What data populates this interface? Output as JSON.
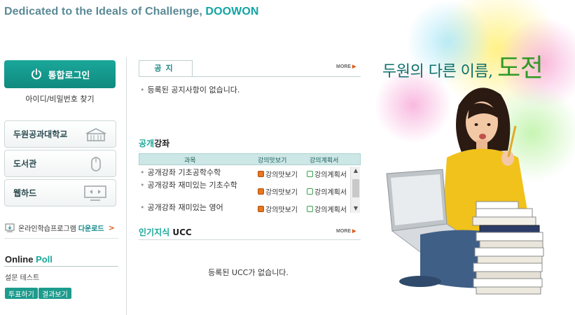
{
  "header": {
    "tagline": "Dedicated to the Ideals of Challenge, ",
    "brand": "DOOWON"
  },
  "sidebar": {
    "login_label": "통합로그인",
    "find_id_label": "아이디/비밀번호 찾기",
    "quick_links": [
      {
        "label": "두원공과대학교",
        "icon": "school-building-icon"
      },
      {
        "label": "도서관",
        "icon": "mouse-icon"
      },
      {
        "label": "웹하드",
        "icon": "monitor-icon"
      }
    ],
    "online_program": {
      "label": "온라인학습프로그램",
      "download_label": "다운로드",
      "arrow": ">"
    },
    "poll": {
      "title_part1": "Online ",
      "title_part2": "Poll",
      "question": "설문 테스트",
      "vote_label": "투표하기",
      "result_label": "결과보기"
    }
  },
  "notice": {
    "tab_label": "공지",
    "more_label": "MORE",
    "empty_text": "등록된 공지사항이 없습니다."
  },
  "lectures": {
    "title_part1": "공개",
    "title_part2": "강좌",
    "columns": {
      "subject": "과목",
      "preview": "강의맛보기",
      "plan": "강의계획서"
    },
    "rows": [
      {
        "title": "공개강좌 기초공학수학",
        "preview": "강의맛보기",
        "plan": "강의계획서"
      },
      {
        "title": "공개강좌 재미있는 기초수학",
        "preview": "강의맛보기",
        "plan": "강의계획서"
      },
      {
        "title": "공개강좌 재미있는 영어",
        "preview": "강의맛보기",
        "plan": "강의계획서"
      }
    ]
  },
  "ucc": {
    "title_part1": "인기지식",
    "title_part2": " UCC",
    "more_label": "MORE",
    "empty_text": "등록된 UCC가 없습니다."
  },
  "visual": {
    "slogan_part1": "두원의 다른 이름, ",
    "slogan_part2": "도전"
  },
  "colors": {
    "accent": "#1aa79a",
    "brand_teal": "#12a4a4",
    "link_orange": "#e05a1a"
  }
}
